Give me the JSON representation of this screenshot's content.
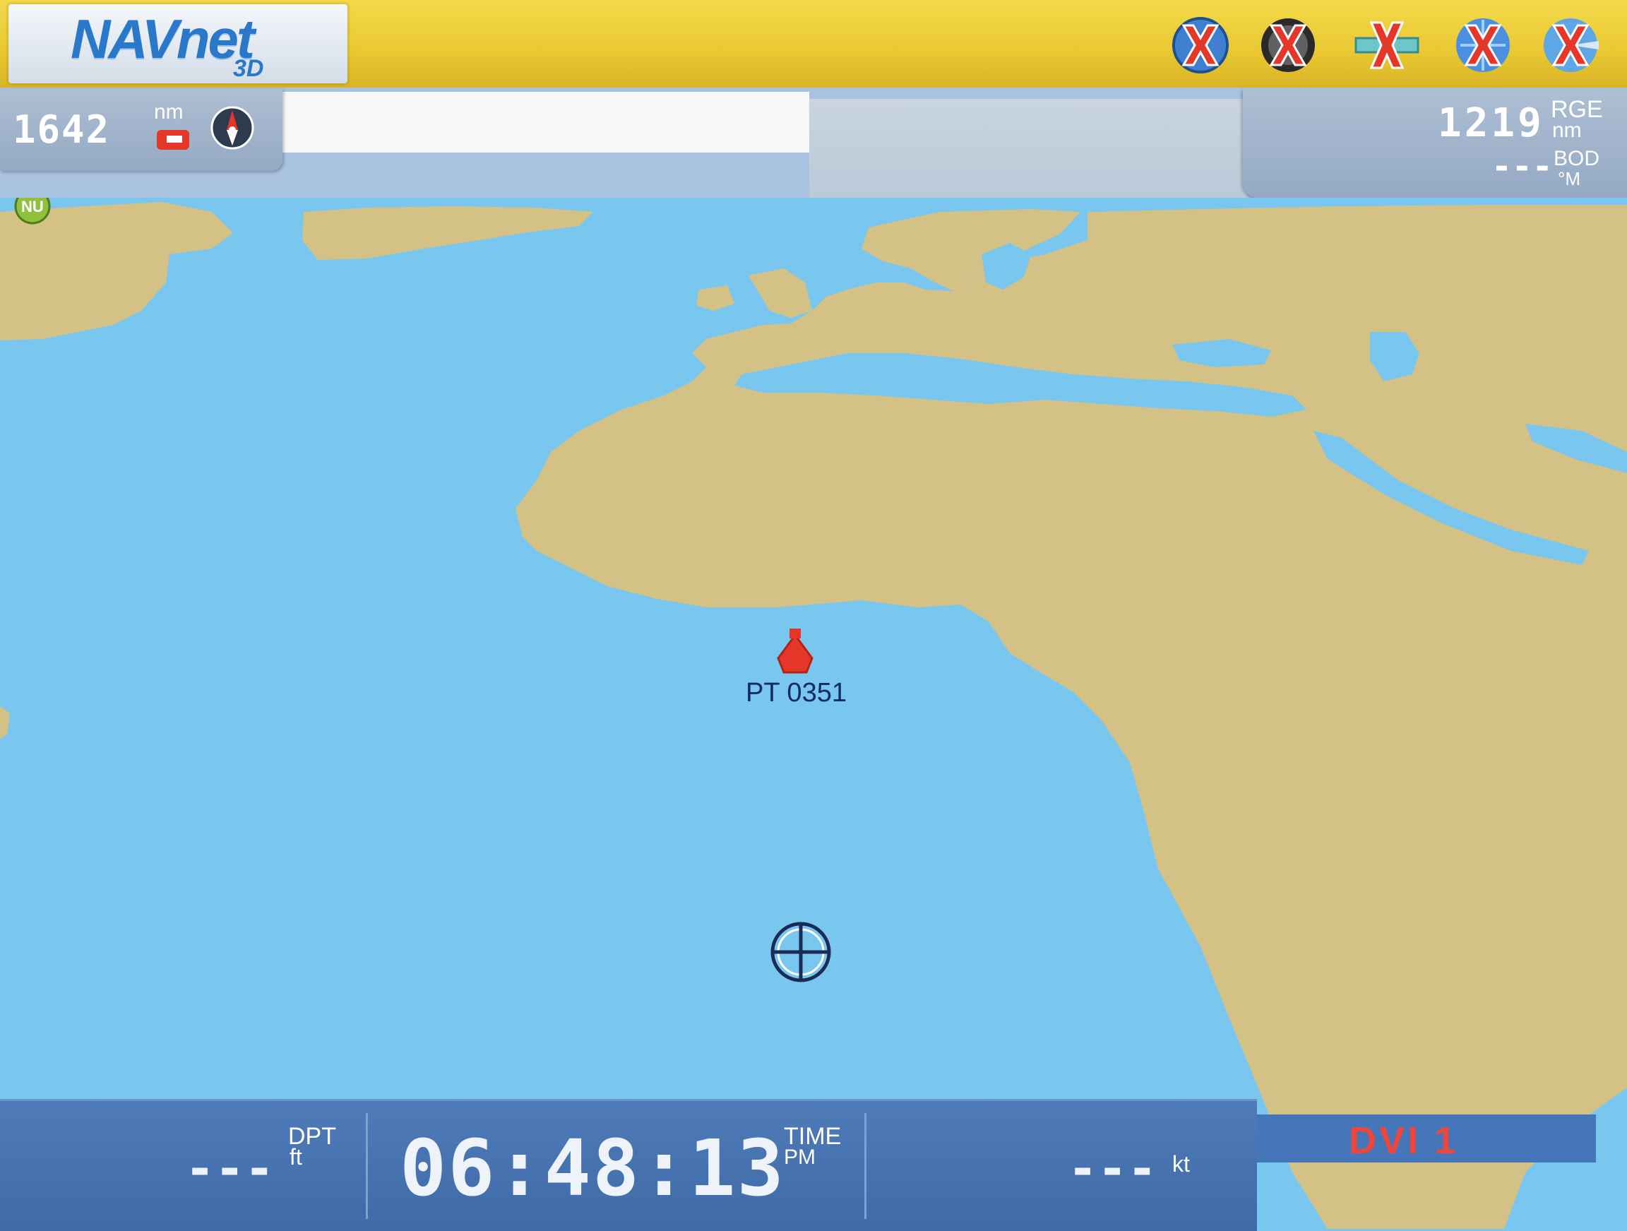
{
  "header": {
    "logo_main": "NAVnet",
    "logo_sub": "3D",
    "status_icons": [
      {
        "icon": "gps-disconnected-icon",
        "color": "#e4372a"
      },
      {
        "icon": "compass-disconnected-icon",
        "color": "#e4372a"
      },
      {
        "icon": "satellite-disconnected-icon",
        "color": "#e4372a"
      },
      {
        "icon": "network-disconnected-icon",
        "color": "#e4372a"
      },
      {
        "icon": "radar-disconnected-icon",
        "color": "#e4372a"
      }
    ]
  },
  "range_box": {
    "value": "1642",
    "unit": "nm"
  },
  "target_box": {
    "rge_value": "1219",
    "rge_label": "RGE",
    "rge_unit": "nm",
    "bod_value": "---",
    "bod_label": "BOD",
    "bod_unit": "°M"
  },
  "map": {
    "north_up_label": "NU",
    "waypoint_label": "PT 0351",
    "colors": {
      "sea": "#79c6ef",
      "land": "#d4c186",
      "ship": "#e4372a"
    }
  },
  "bottom": {
    "depth_value": "---",
    "depth_label": "DPT",
    "depth_unit": "ft",
    "time_value": "06:48:13",
    "time_label": "TIME",
    "time_ampm": "PM",
    "speed_value": "---",
    "speed_unit": "kt",
    "input_source": "DVI 1"
  }
}
